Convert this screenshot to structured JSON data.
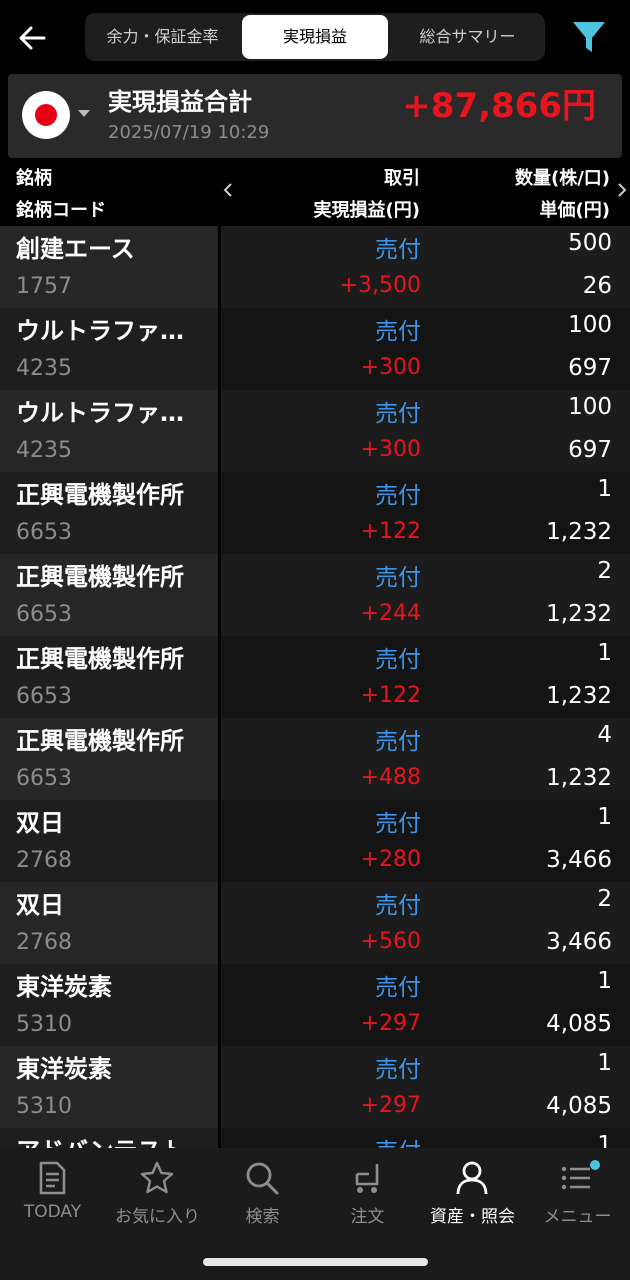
{
  "header": {
    "tabs": [
      {
        "label": "余力・保証金率"
      },
      {
        "label": "実現損益"
      },
      {
        "label": "総合サマリー"
      }
    ]
  },
  "summary": {
    "title": "実現損益合計",
    "date": "2025/07/19 10:29",
    "value": "+87,866円"
  },
  "columns": {
    "name": "銘柄",
    "code": "銘柄コード",
    "trade": "取引",
    "pnl": "実現損益(円)",
    "qty": "数量(株/口)",
    "price": "単価(円)"
  },
  "rows": [
    {
      "name": "創建エース",
      "code": "1757",
      "trade": "売付",
      "pnl": "+3,500",
      "qty": "500",
      "price": "26"
    },
    {
      "name": "ウルトラファ…",
      "code": "4235",
      "trade": "売付",
      "pnl": "+300",
      "qty": "100",
      "price": "697"
    },
    {
      "name": "ウルトラファ…",
      "code": "4235",
      "trade": "売付",
      "pnl": "+300",
      "qty": "100",
      "price": "697"
    },
    {
      "name": "正興電機製作所",
      "code": "6653",
      "trade": "売付",
      "pnl": "+122",
      "qty": "1",
      "price": "1,232"
    },
    {
      "name": "正興電機製作所",
      "code": "6653",
      "trade": "売付",
      "pnl": "+244",
      "qty": "2",
      "price": "1,232"
    },
    {
      "name": "正興電機製作所",
      "code": "6653",
      "trade": "売付",
      "pnl": "+122",
      "qty": "1",
      "price": "1,232"
    },
    {
      "name": "正興電機製作所",
      "code": "6653",
      "trade": "売付",
      "pnl": "+488",
      "qty": "4",
      "price": "1,232"
    },
    {
      "name": "双日",
      "code": "2768",
      "trade": "売付",
      "pnl": "+280",
      "qty": "1",
      "price": "3,466"
    },
    {
      "name": "双日",
      "code": "2768",
      "trade": "売付",
      "pnl": "+560",
      "qty": "2",
      "price": "3,466"
    },
    {
      "name": "東洋炭素",
      "code": "5310",
      "trade": "売付",
      "pnl": "+297",
      "qty": "1",
      "price": "4,085"
    },
    {
      "name": "東洋炭素",
      "code": "5310",
      "trade": "売付",
      "pnl": "+297",
      "qty": "1",
      "price": "4,085"
    },
    {
      "name": "アドバンテスト",
      "code": "",
      "trade": "売付",
      "pnl": "",
      "qty": "1",
      "price": ""
    }
  ],
  "nav": [
    {
      "label": "TODAY",
      "icon": "document-icon"
    },
    {
      "label": "お気に入り",
      "icon": "star-icon"
    },
    {
      "label": "検索",
      "icon": "search-icon"
    },
    {
      "label": "注文",
      "icon": "cart-icon"
    },
    {
      "label": "資産・照会",
      "icon": "person-icon"
    },
    {
      "label": "メニュー",
      "icon": "menu-icon"
    }
  ],
  "colors": {
    "profit": "#e8141e",
    "trade": "#3d94e6",
    "filter": "#4fc4e0",
    "badge": "#4fc4e0"
  }
}
